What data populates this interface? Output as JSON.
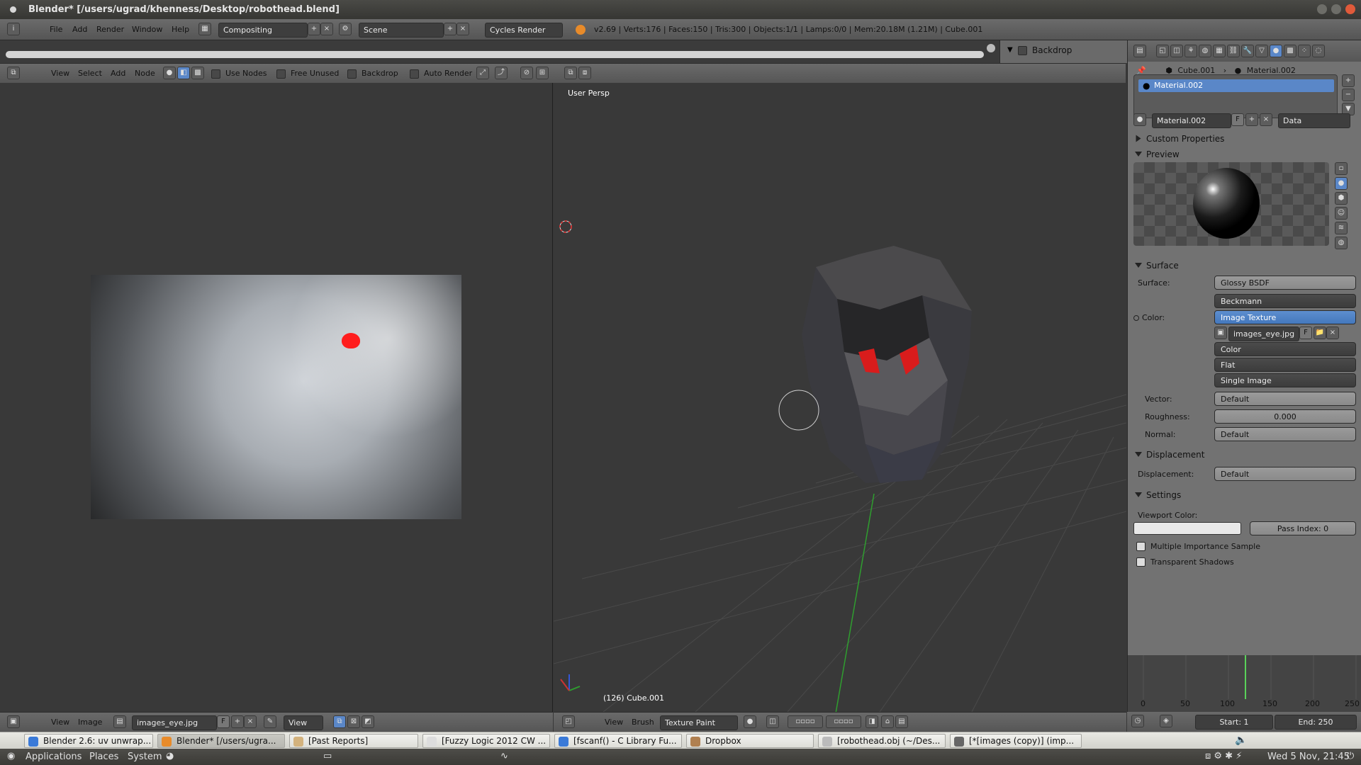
{
  "window": {
    "title": "Blender* [/users/ugrad/khenness/Desktop/robothead.blend]"
  },
  "info_header": {
    "menus": [
      "File",
      "Add",
      "Render",
      "Window",
      "Help"
    ],
    "layout": "Compositing",
    "scene": "Scene",
    "engine": "Cycles Render",
    "stats": "v2.69 | Verts:176 | Faces:150 | Tris:300 | Objects:1/1 | Lamps:0/0 | Mem:20.18M (1.21M) | Cube.001"
  },
  "node_editor": {
    "menus": [
      "View",
      "Select",
      "Add",
      "Node"
    ],
    "checkboxes": [
      "Use Nodes",
      "Free Unused",
      "Backdrop",
      "Auto Render"
    ],
    "side_panel_label": "Backdrop"
  },
  "image_editor": {
    "menus": [
      "View",
      "Image"
    ],
    "image_name": "images_eye.jpg",
    "fake_user": "F",
    "view_label": "View"
  },
  "viewport": {
    "label": "User Persp",
    "object_text": "(126) Cube.001",
    "menus": [
      "View",
      "Brush"
    ],
    "mode": "Texture Paint"
  },
  "properties": {
    "breadcrumb": [
      "Cube.001",
      "Material.002"
    ],
    "slot": "Material.002",
    "material_field": "Material.002",
    "fake_user": "F",
    "link": "Data",
    "sections": {
      "custom": "Custom Properties",
      "preview": "Preview",
      "surface": "Surface",
      "displacement": "Displacement",
      "settings": "Settings"
    },
    "surface": {
      "surface_label": "Surface:",
      "surface_value": "Glossy BSDF",
      "distribution": "Beckmann",
      "color_label": "Color:",
      "color_value": "Image Texture",
      "image": "images_eye.jpg",
      "image_f": "F",
      "color_space": "Color",
      "projection": "Flat",
      "source": "Single Image",
      "vector_label": "Vector:",
      "vector_value": "Default",
      "roughness_label": "Roughness:",
      "roughness_value": "0.000",
      "normal_label": "Normal:",
      "normal_value": "Default"
    },
    "displacement": {
      "label": "Displacement:",
      "value": "Default"
    },
    "settings": {
      "viewport_color_label": "Viewport Color:",
      "pass_index": "Pass Index: 0",
      "mis": "Multiple Importance Sample",
      "transparent": "Transparent Shadows"
    }
  },
  "timeline": {
    "ticks": [
      "0",
      "50",
      "100",
      "150",
      "200",
      "250"
    ],
    "start": "Start: 1",
    "end": "End: 250"
  },
  "taskbar": {
    "tasks": [
      "Blender 2.6: uv unwrap...",
      "Blender* [/users/ugra...",
      "[Past Reports]",
      "[Fuzzy Logic 2012 CW ...",
      "[fscanf() - C Library Fu...",
      "Dropbox",
      "[robothead.obj (~/Des...",
      "[*[images (copy)] (imp..."
    ]
  },
  "gnome_panel": {
    "menus": [
      "Applications",
      "Places",
      "System"
    ],
    "clock": "Wed  5 Nov, 21:45"
  }
}
